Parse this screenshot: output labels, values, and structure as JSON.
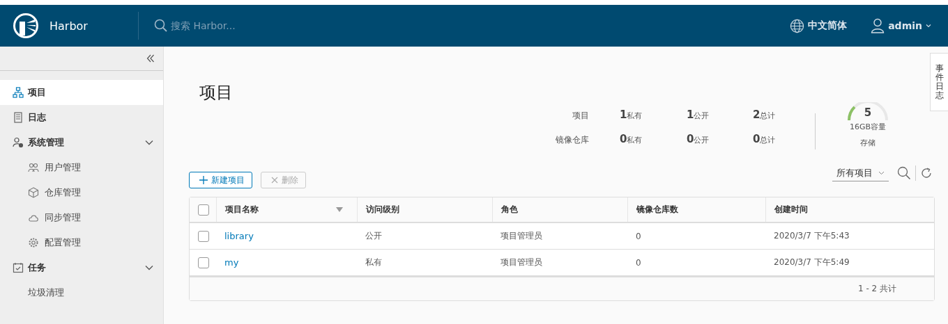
{
  "header": {
    "brand": "Harbor",
    "search": {
      "placeholder": "搜索 Harbor..."
    },
    "language": "中文简体",
    "user": "admin"
  },
  "sidebar": {
    "items": [
      {
        "label": "项目",
        "selected": true
      },
      {
        "label": "日志",
        "selected": false
      },
      {
        "label": "系统管理",
        "selected": false,
        "expanded": true,
        "children": [
          {
            "label": "用户管理",
            "selected": false
          },
          {
            "label": "仓库管理",
            "selected": false
          },
          {
            "label": "同步管理",
            "selected": false
          },
          {
            "label": "配置管理",
            "selected": false
          }
        ]
      },
      {
        "label": "任务",
        "selected": false,
        "expanded": true,
        "children": [
          {
            "label": "垃圾清理",
            "selected": false
          }
        ]
      }
    ]
  },
  "page_title": "项目",
  "event_log_tab": "事件日志",
  "stats": {
    "rows": [
      {
        "label": "项目",
        "cells": [
          {
            "value": "1",
            "unit": "私有"
          },
          {
            "value": "1",
            "unit": "公开"
          },
          {
            "value": "2",
            "unit": "总计"
          }
        ]
      },
      {
        "label": "镜像仓库",
        "cells": [
          {
            "value": "0",
            "unit": "私有"
          },
          {
            "value": "0",
            "unit": "公开"
          },
          {
            "value": "0",
            "unit": "总计"
          }
        ]
      }
    ],
    "storage": {
      "value": "5",
      "capacity": "16GB容量",
      "label": "存储"
    }
  },
  "toolbar": {
    "new_button": {
      "label": "新建项目",
      "disabled": false
    },
    "delete_button": {
      "label": "删除",
      "disabled": true
    },
    "filter": "所有项目"
  },
  "table": {
    "select_all_checked": false,
    "columns": [
      "项目名称",
      "访问级别",
      "角色",
      "镜像仓库数",
      "创建时间"
    ],
    "rows": [
      {
        "checked": false,
        "cells": [
          "library",
          "公开",
          "项目管理员",
          "0",
          "2020/3/7 下午5:43"
        ]
      },
      {
        "checked": false,
        "cells": [
          "my",
          "私有",
          "项目管理员",
          "0",
          "2020/3/7 下午5:49"
        ]
      }
    ],
    "footer": "1 - 2 共计"
  }
}
